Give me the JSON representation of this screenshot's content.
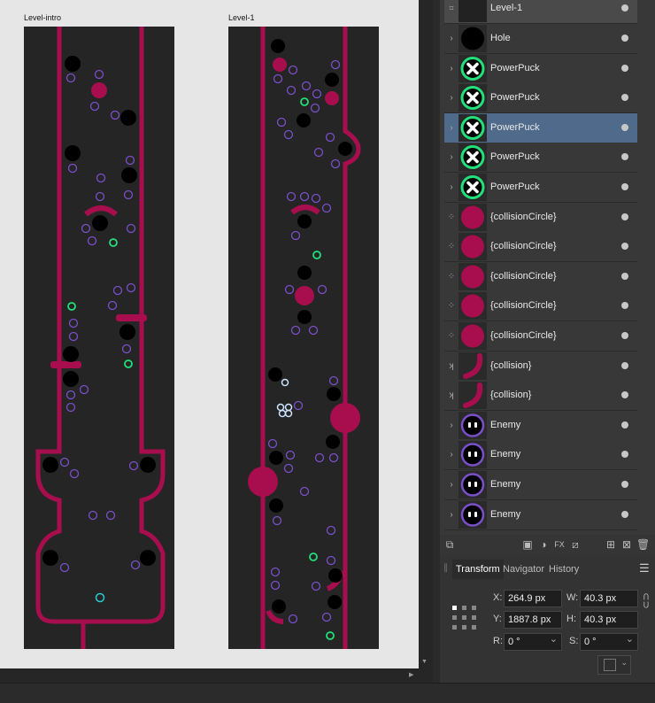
{
  "canvas": {
    "artboards": [
      {
        "title": "Level-intro"
      },
      {
        "title": "Level-1"
      }
    ],
    "colors": {
      "track": "#a80e4e",
      "board": "#252525",
      "background": "#e6e6e6",
      "enemy": "#7a4fc9",
      "powerpuck": "#22e07a"
    }
  },
  "layers": {
    "header": "Level-1",
    "items": [
      {
        "name": "Hole",
        "thumb": "hole"
      },
      {
        "name": "PowerPuck",
        "thumb": "powerpuck"
      },
      {
        "name": "PowerPuck",
        "thumb": "powerpuck"
      },
      {
        "name": "PowerPuck",
        "thumb": "powerpuck",
        "selected": true
      },
      {
        "name": "PowerPuck",
        "thumb": "powerpuck"
      },
      {
        "name": "PowerPuck",
        "thumb": "powerpuck"
      },
      {
        "name": "{collisionCircle}",
        "thumb": "circle"
      },
      {
        "name": "{collisionCircle}",
        "thumb": "circle"
      },
      {
        "name": "{collisionCircle}",
        "thumb": "circle"
      },
      {
        "name": "{collisionCircle}",
        "thumb": "circle"
      },
      {
        "name": "{collisionCircle}",
        "thumb": "circle"
      },
      {
        "name": "{collision}",
        "thumb": "curve"
      },
      {
        "name": "{collision}",
        "thumb": "curve"
      },
      {
        "name": "Enemy",
        "thumb": "enemy"
      },
      {
        "name": "Enemy",
        "thumb": "enemy"
      },
      {
        "name": "Enemy",
        "thumb": "enemy"
      },
      {
        "name": "Enemy",
        "thumb": "enemy"
      }
    ]
  },
  "transform_panel": {
    "tabs": [
      "Transform",
      "Navigator",
      "History"
    ],
    "active_tab": "Transform",
    "x_label": "X:",
    "x_value": "264.9 px",
    "y_label": "Y:",
    "y_value": "1887.8 px",
    "w_label": "W:",
    "w_value": "40.3 px",
    "h_label": "H:",
    "h_value": "40.3 px",
    "r_label": "R:",
    "r_value": "0 °",
    "s_label": "S:",
    "s_value": "0 °"
  }
}
